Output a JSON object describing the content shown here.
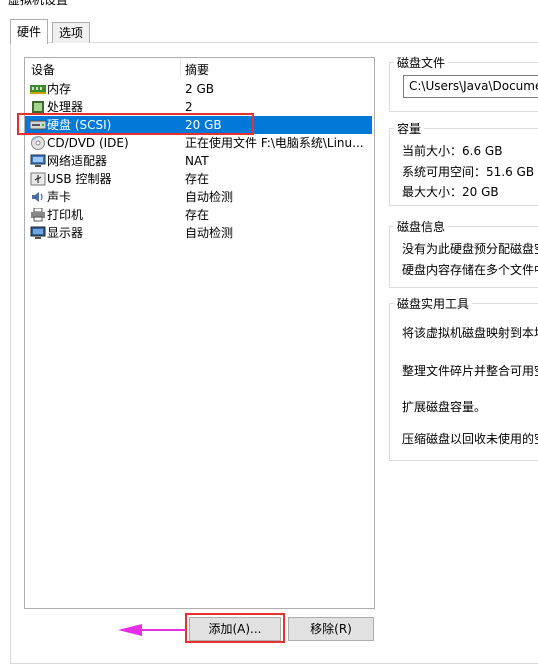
{
  "window": {
    "title": "虚拟机设置"
  },
  "tabs": [
    {
      "label": "硬件"
    },
    {
      "label": "选项"
    }
  ],
  "device_list": {
    "col_device": "设备",
    "col_summary": "摘要",
    "rows": [
      {
        "name": "内存",
        "summary": "2 GB",
        "icon": "memory-icon"
      },
      {
        "name": "处理器",
        "summary": "2",
        "icon": "processor-icon"
      },
      {
        "name": "硬盘 (SCSI)",
        "summary": "20 GB",
        "icon": "hard-disk-icon"
      },
      {
        "name": "CD/DVD (IDE)",
        "summary": "正在使用文件 F:\\电脑系统\\Linu...",
        "icon": "cd-dvd-icon"
      },
      {
        "name": "网络适配器",
        "summary": "NAT",
        "icon": "network-adapter-icon"
      },
      {
        "name": "USB 控制器",
        "summary": "存在",
        "icon": "usb-icon"
      },
      {
        "name": "声卡",
        "summary": "自动检测",
        "icon": "sound-card-icon"
      },
      {
        "name": "打印机",
        "summary": "存在",
        "icon": "printer-icon"
      },
      {
        "name": "显示器",
        "summary": "自动检测",
        "icon": "display-icon"
      }
    ]
  },
  "buttons": {
    "add": "添加(A)...",
    "remove": "移除(R)"
  },
  "disk_file": {
    "label": "磁盘文件",
    "path": "C:\\Users\\Java\\Documen"
  },
  "capacity": {
    "label": "容量",
    "current": "当前大小：6.6 GB",
    "available": "系统可用空间：51.6 GB",
    "max": "最大大小：20 GB"
  },
  "disk_info": {
    "label": "磁盘信息",
    "line1": "没有为此硬盘预分配磁盘空",
    "line2": "硬盘内容存储在多个文件中"
  },
  "utilities": {
    "label": "磁盘实用工具",
    "map": "将该虚拟机磁盘映射到本地",
    "defrag": "整理文件碎片并整合可用空",
    "expand": "扩展磁盘容量。",
    "compact": "压缩磁盘以回收未使用的空"
  },
  "colors": {
    "selection": "#0078d7",
    "highlight_box": "#e8312f",
    "arrow": "#e62ee6"
  }
}
